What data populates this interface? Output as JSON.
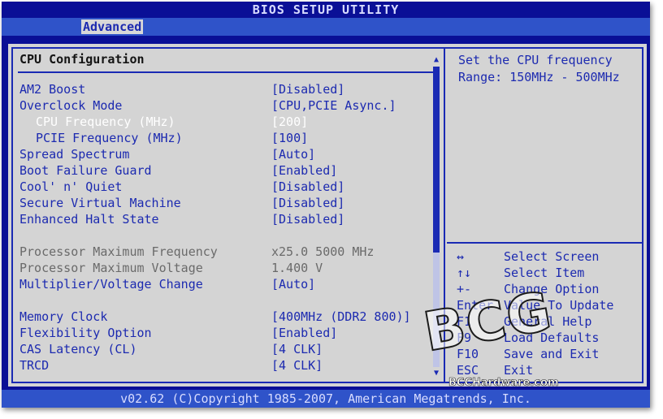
{
  "window": {
    "title": "BIOS SETUP UTILITY",
    "active_tab": "Advanced"
  },
  "main": {
    "section_title": "CPU Configuration",
    "settings": [
      {
        "label": "AM2 Boost",
        "value": "[Disabled]",
        "indent": false,
        "style": "blue"
      },
      {
        "label": "Overclock Mode",
        "value": "[CPU,PCIE Async.]",
        "indent": false,
        "style": "blue"
      },
      {
        "label": "CPU Frequency (MHz)",
        "value": "[200]",
        "indent": true,
        "style": "selected"
      },
      {
        "label": "PCIE Frequency (MHz)",
        "value": "[100]",
        "indent": true,
        "style": "blue"
      },
      {
        "label": "Spread Spectrum",
        "value": "[Auto]",
        "indent": false,
        "style": "blue"
      },
      {
        "label": "Boot Failure Guard",
        "value": "[Enabled]",
        "indent": false,
        "style": "blue"
      },
      {
        "label": "Cool' n' Quiet",
        "value": "[Disabled]",
        "indent": false,
        "style": "blue"
      },
      {
        "label": "Secure Virtual Machine",
        "value": "[Disabled]",
        "indent": false,
        "style": "blue"
      },
      {
        "label": "Enhanced Halt State",
        "value": "[Disabled]",
        "indent": false,
        "style": "blue"
      },
      {
        "label": "",
        "value": "",
        "indent": false,
        "style": "spacer"
      },
      {
        "label": "Processor Maximum Frequency",
        "value": "x25.0 5000 MHz",
        "indent": false,
        "style": "gray"
      },
      {
        "label": "Processor Maximum Voltage",
        "value": "1.400 V",
        "indent": false,
        "style": "gray"
      },
      {
        "label": "Multiplier/Voltage Change",
        "value": "[Auto]",
        "indent": false,
        "style": "blue"
      },
      {
        "label": "",
        "value": "",
        "indent": false,
        "style": "spacer"
      },
      {
        "label": "Memory Clock",
        "value": "[400MHz (DDR2 800)]",
        "indent": false,
        "style": "blue"
      },
      {
        "label": "Flexibility Option",
        "value": "[Enabled]",
        "indent": false,
        "style": "blue"
      },
      {
        "label": "CAS Latency (CL)",
        "value": "[4 CLK]",
        "indent": false,
        "style": "blue"
      },
      {
        "label": "TRCD",
        "value": "[4 CLK]",
        "indent": false,
        "style": "blue"
      }
    ],
    "scroll_position": 0.62
  },
  "help": {
    "text": "Set the CPU frequency\nRange: 150MHz - 500MHz"
  },
  "keys": [
    {
      "key": "↔",
      "desc": "Select Screen"
    },
    {
      "key": "↑↓",
      "desc": "Select Item"
    },
    {
      "key": "+-",
      "desc": "Change Option"
    },
    {
      "key": "Enter",
      "desc": "Value To Update"
    },
    {
      "key": "F1",
      "desc": "General Help"
    },
    {
      "key": "F9",
      "desc": "Load Defaults"
    },
    {
      "key": "F10",
      "desc": "Save and Exit"
    },
    {
      "key": "ESC",
      "desc": "Exit"
    }
  ],
  "footer": {
    "copyright": "v02.62 (C)Copyright 1985-2007, American Megatrends, Inc."
  },
  "watermark": {
    "big": "BCG",
    "small": "BCCHardware.com"
  },
  "colors": {
    "frame": "#0a0f96",
    "bar": "#2f53c9",
    "panel": "#d4d4d4",
    "accent": "#1c2ab0",
    "selected": "#ffffff",
    "inactive": "#6a6a6a"
  }
}
